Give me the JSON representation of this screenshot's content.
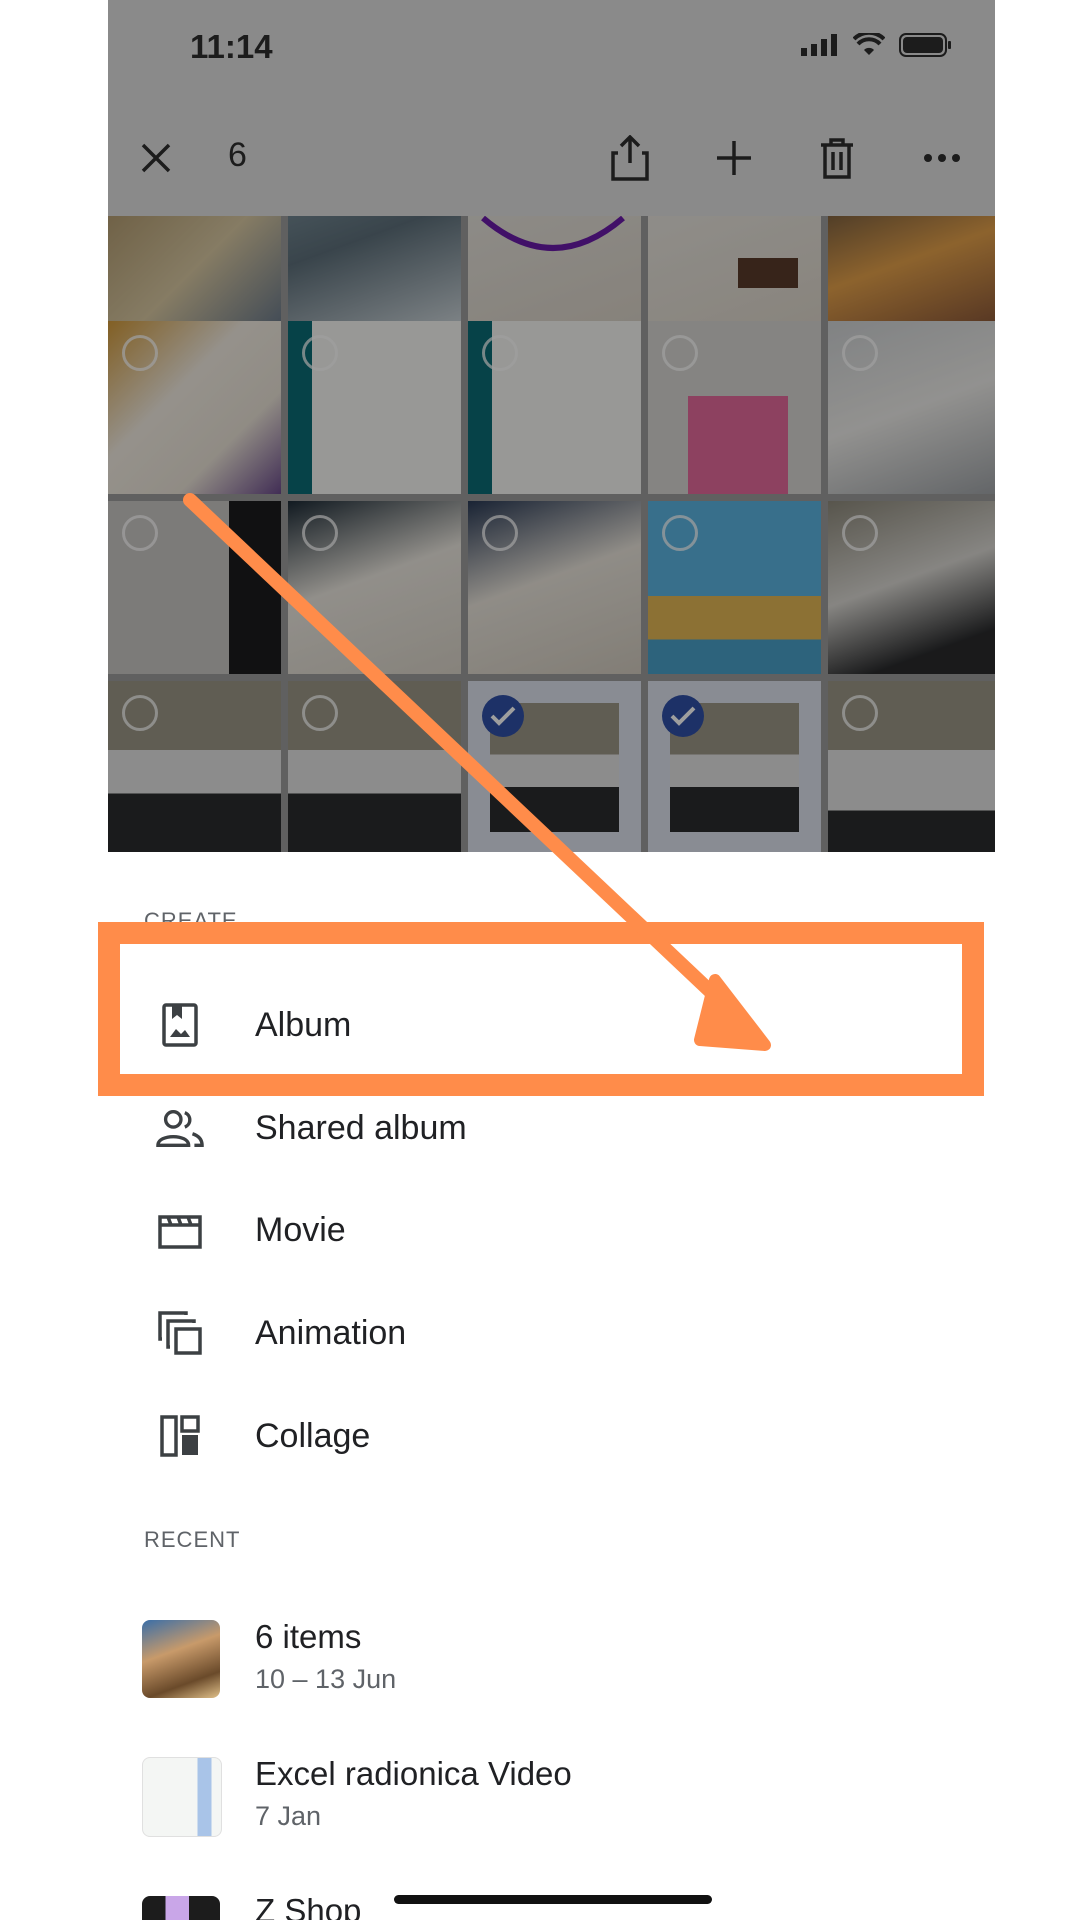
{
  "status_bar": {
    "time": "11:14"
  },
  "toolbar": {
    "selected_count": "6"
  },
  "sheet": {
    "create_label": "CREATE",
    "create_items": [
      {
        "label": "Album",
        "icon": "album-icon"
      },
      {
        "label": "Shared album",
        "icon": "shared-album-icon"
      },
      {
        "label": "Movie",
        "icon": "movie-icon"
      },
      {
        "label": "Animation",
        "icon": "animation-icon"
      },
      {
        "label": "Collage",
        "icon": "collage-icon"
      }
    ],
    "recent_label": "RECENT",
    "recent_items": [
      {
        "title": "6 items",
        "subtitle": "10 – 13 Jun"
      },
      {
        "title": "Excel radionica Video",
        "subtitle": "7 Jan"
      },
      {
        "title": "Z Shop",
        "subtitle": ""
      }
    ]
  },
  "colors": {
    "highlight": "#ff8c4a",
    "check": "#2f4fa6",
    "dim_overlay": "#8a8a8a"
  }
}
